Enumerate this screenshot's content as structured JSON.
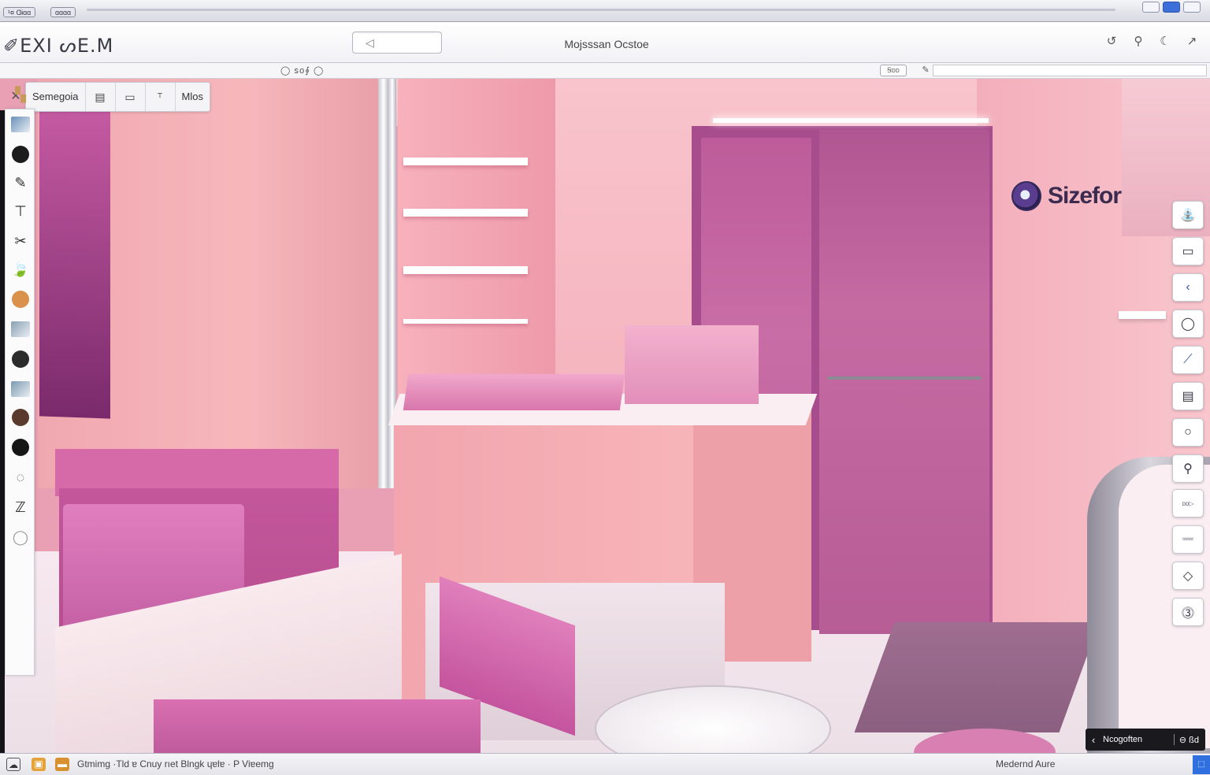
{
  "os": {
    "pill_left": "¹¤ Ɑɨɑɑ",
    "pill_right": "ɑɑɑɑ"
  },
  "app": {
    "logo": "✐EXI ᔕE.M",
    "search_glyph": "◁",
    "document_title": "Mojsssan Ocstoe",
    "toolbar_icons": [
      "refresh-icon",
      "search-icon",
      "moon-icon",
      "share-icon"
    ]
  },
  "viewport_bar": {
    "scale_label": "◯ ꜱo∮ ◯",
    "chip_label": "Ꞩᴅᴅ",
    "edit_glyph": "✎"
  },
  "viewport_tabs": {
    "close_glyph": "✕",
    "tab_label": "Semegoia",
    "tool_glyphs": [
      "▤",
      "▭",
      "⸆"
    ],
    "mode_label": "Mlos"
  },
  "brand": {
    "text": "Sizefor"
  },
  "left_palette": [
    {
      "name": "pushpin-tool",
      "kind": "glyph",
      "glyph": "▚",
      "color": "#c89a5a"
    },
    {
      "name": "image-tool",
      "kind": "thumb",
      "color": "#6a8fb8"
    },
    {
      "name": "orbit-tool",
      "kind": "circle",
      "color": "#1c1c1c"
    },
    {
      "name": "pencil-tool",
      "kind": "glyph",
      "glyph": "✎",
      "color": "#2a2a2a"
    },
    {
      "name": "hammer-tool",
      "kind": "glyph",
      "glyph": "⊤",
      "color": "#2a2a2a"
    },
    {
      "name": "scissors-tool",
      "kind": "glyph",
      "glyph": "✂",
      "color": "#2a2a2a"
    },
    {
      "name": "leaf-tool",
      "kind": "glyph",
      "glyph": "🍃",
      "color": "#2a2a2a"
    },
    {
      "name": "paint-tool",
      "kind": "circle",
      "color": "#d9914c"
    },
    {
      "name": "landscape-tool",
      "kind": "thumb",
      "color": "#8aa0b2"
    },
    {
      "name": "sphere-tool",
      "kind": "circle",
      "color": "#2b2b2b"
    },
    {
      "name": "photo-tool",
      "kind": "thumb",
      "color": "#7b9ab0"
    },
    {
      "name": "material-tool",
      "kind": "circle",
      "color": "#5a3a2c"
    },
    {
      "name": "dark-sphere-tool",
      "kind": "circle",
      "color": "#161616"
    },
    {
      "name": "eraser-tool",
      "kind": "glyph",
      "glyph": "◌",
      "color": "#666"
    },
    {
      "name": "text-tool",
      "kind": "glyph",
      "glyph": "ℤ",
      "color": "#2a2a2a"
    },
    {
      "name": "ghost-tool",
      "kind": "glyph",
      "glyph": "◯",
      "color": "#999"
    }
  ],
  "right_palette": [
    {
      "name": "sink-icon",
      "glyph": "⛲",
      "style": ""
    },
    {
      "name": "window-icon",
      "glyph": "▭",
      "style": ""
    },
    {
      "name": "back-arrow-icon",
      "glyph": "‹",
      "style": "accent"
    },
    {
      "name": "circle-icon",
      "glyph": "◯",
      "style": ""
    },
    {
      "name": "pen-icon",
      "glyph": "⟋",
      "style": "accent"
    },
    {
      "name": "list-icon",
      "glyph": "▤",
      "style": ""
    },
    {
      "name": "ring-icon",
      "glyph": "○",
      "style": ""
    },
    {
      "name": "search-tool-icon",
      "glyph": "⚲",
      "style": ""
    },
    {
      "name": "arrow-label-icon",
      "glyph": "ᴅᴅ▷",
      "style": "small"
    },
    {
      "name": "label-icon",
      "glyph": "ᴵᵈᵈᵈᵈ",
      "style": "small"
    },
    {
      "name": "diamond-icon",
      "glyph": "◇",
      "style": ""
    },
    {
      "name": "help-icon",
      "glyph": "⓷",
      "style": ""
    }
  ],
  "nav_pill": {
    "back_glyph": "‹",
    "label": "Ncogoften",
    "right_label": "⊖ ßd"
  },
  "status": {
    "left_text": "Gtmimg ·Tld ɐ Cnuy rıet Blngk ɥɐlɐ · P Viɐemg",
    "right_text": "Medernd Aure",
    "corner_glyph": "⬚"
  },
  "colors": {
    "accent": "#3952a6",
    "wall_pink": "#f0a8b0",
    "magenta": "#c4579b",
    "door": "#b05692"
  }
}
